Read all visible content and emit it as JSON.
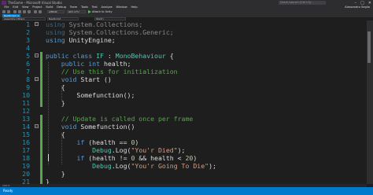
{
  "window": {
    "title": "TheGame - Microsoft Visual Studio",
    "quick_launch_placeholder": "Quick Launch (Ctrl+Q)",
    "user": "Alessandro Seglia"
  },
  "menu": {
    "items": [
      "File",
      "Edit",
      "View",
      "Project",
      "Build",
      "Debug",
      "Team",
      "Tools",
      "Test",
      "Analyze",
      "Window",
      "Help"
    ]
  },
  "toolbar": {
    "config": "Debug",
    "platform": "Any CPU",
    "attach_label": "Attach to Unity"
  },
  "tab": {
    "label": "NewScript.cs"
  },
  "nav": {
    "project": "Assembly-CSharp",
    "class": "NewScript",
    "member": "Start()"
  },
  "editor": {
    "lines": [
      {
        "n": "1",
        "parts": [
          {
            "c": "kw",
            "t": "using"
          },
          {
            "c": "tx",
            "t": " System.Collections;"
          }
        ]
      },
      {
        "n": "2",
        "parts": [
          {
            "c": "kw",
            "t": "using"
          },
          {
            "c": "tx",
            "t": " System.Collections.Generic;"
          }
        ]
      },
      {
        "n": "3",
        "parts": [
          {
            "c": "kw",
            "t": "using"
          },
          {
            "c": "tx",
            "t": " UnityEngine;"
          }
        ]
      },
      {
        "n": "4",
        "parts": []
      },
      {
        "n": "5",
        "parts": [
          {
            "c": "kw",
            "t": "public"
          },
          {
            "c": "tx",
            "t": " "
          },
          {
            "c": "kw",
            "t": "class"
          },
          {
            "c": "tx",
            "t": " "
          },
          {
            "c": "ty",
            "t": "IF"
          },
          {
            "c": "tx",
            "t": " : "
          },
          {
            "c": "ty",
            "t": "MonoBehaviour"
          },
          {
            "c": "tx",
            "t": " {"
          }
        ]
      },
      {
        "n": "6",
        "parts": [
          {
            "c": "tx",
            "t": "    "
          },
          {
            "c": "kw",
            "t": "public"
          },
          {
            "c": "tx",
            "t": " "
          },
          {
            "c": "kw",
            "t": "int"
          },
          {
            "c": "tx",
            "t": " health;"
          }
        ]
      },
      {
        "n": "7",
        "parts": [
          {
            "c": "tx",
            "t": "    "
          },
          {
            "c": "cm",
            "t": "// Use this for initialization"
          }
        ]
      },
      {
        "n": "8",
        "parts": [
          {
            "c": "tx",
            "t": "    "
          },
          {
            "c": "kw",
            "t": "void"
          },
          {
            "c": "tx",
            "t": " Start ()"
          }
        ]
      },
      {
        "n": "9",
        "parts": [
          {
            "c": "tx",
            "t": "    {"
          }
        ]
      },
      {
        "n": "10",
        "parts": [
          {
            "c": "tx",
            "t": "        Somefunction();"
          }
        ]
      },
      {
        "n": "11",
        "parts": [
          {
            "c": "tx",
            "t": "    }"
          }
        ]
      },
      {
        "n": "12",
        "parts": []
      },
      {
        "n": "13",
        "parts": [
          {
            "c": "tx",
            "t": "    "
          },
          {
            "c": "cm",
            "t": "// Update is called once per frame"
          }
        ]
      },
      {
        "n": "14",
        "parts": [
          {
            "c": "tx",
            "t": "    "
          },
          {
            "c": "kw",
            "t": "void"
          },
          {
            "c": "tx",
            "t": " Somefunction()"
          }
        ]
      },
      {
        "n": "15",
        "parts": [
          {
            "c": "tx",
            "t": "    {"
          }
        ]
      },
      {
        "n": "16",
        "parts": [
          {
            "c": "tx",
            "t": "        "
          },
          {
            "c": "kw",
            "t": "if"
          },
          {
            "c": "tx",
            "t": " (health == "
          },
          {
            "c": "nu",
            "t": "0"
          },
          {
            "c": "tx",
            "t": ")"
          }
        ]
      },
      {
        "n": "17",
        "parts": [
          {
            "c": "tx",
            "t": "            "
          },
          {
            "c": "ty",
            "t": "Debug"
          },
          {
            "c": "tx",
            "t": ".Log("
          },
          {
            "c": "st",
            "t": "\"You'r Died\""
          },
          {
            "c": "tx",
            "t": ");"
          }
        ]
      },
      {
        "n": "18",
        "parts": [
          {
            "c": "tx",
            "t": "        "
          },
          {
            "c": "kw",
            "t": "if"
          },
          {
            "c": "tx",
            "t": " (health != "
          },
          {
            "c": "nu",
            "t": "0"
          },
          {
            "c": "tx",
            "t": " && health < "
          },
          {
            "c": "nu",
            "t": "20"
          },
          {
            "c": "tx",
            "t": ")"
          }
        ]
      },
      {
        "n": "19",
        "parts": [
          {
            "c": "tx",
            "t": "            "
          },
          {
            "c": "ty",
            "t": "Debug"
          },
          {
            "c": "tx",
            "t": ".Log("
          },
          {
            "c": "st",
            "t": "\"You'r Going To Die\""
          },
          {
            "c": "tx",
            "t": ");"
          }
        ]
      },
      {
        "n": "20",
        "parts": [
          {
            "c": "tx",
            "t": "    }"
          }
        ]
      },
      {
        "n": "21",
        "parts": [
          {
            "c": "tx",
            "t": "}"
          }
        ]
      }
    ],
    "changed_lines": [
      "5",
      "6",
      "7",
      "8",
      "9",
      "10",
      "11",
      "13",
      "14",
      "15",
      "16",
      "17",
      "18",
      "19",
      "20",
      "21"
    ],
    "dimmed_lines": [
      "1",
      "2"
    ]
  },
  "zoom": "100 %",
  "status": {
    "text": "Ready"
  },
  "colors": {
    "accent": "#007acc",
    "keyword": "#569cd6",
    "type": "#4ec9b0",
    "comment": "#57a64a",
    "string": "#d69d85",
    "line_number": "#2b91af"
  }
}
